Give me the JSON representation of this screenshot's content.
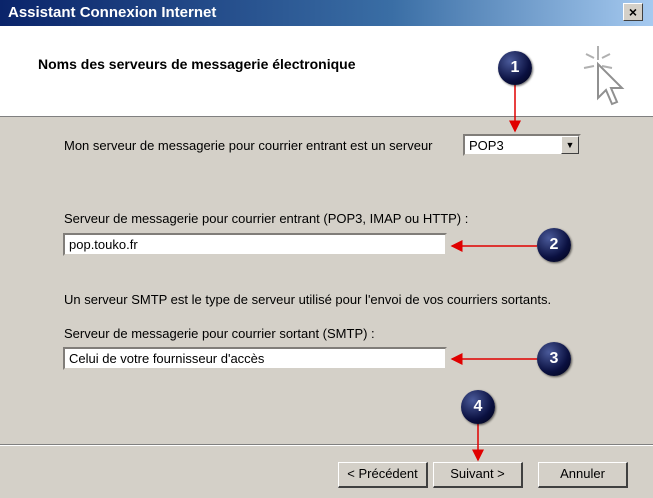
{
  "window": {
    "title": "Assistant Connexion Internet",
    "close_glyph": "×"
  },
  "header": {
    "title": "Noms des serveurs de messagerie électronique"
  },
  "form": {
    "incoming_type_label": "Mon serveur de messagerie pour courrier entrant est un serveur",
    "incoming_type_value": "POP3",
    "incoming_server_label": "Serveur de messagerie pour courrier entrant (POP3, IMAP ou HTTP) :",
    "incoming_server_value": "pop.touko.fr",
    "smtp_note": "Un serveur SMTP est le type de serveur utilisé pour l'envoi de vos courriers sortants.",
    "outgoing_server_label": "Serveur de messagerie pour courrier sortant (SMTP) :",
    "outgoing_server_value": "Celui de votre fournisseur d'accès"
  },
  "buttons": {
    "previous": "< Précédent",
    "next": "Suivant >",
    "cancel": "Annuler"
  },
  "annotations": {
    "badge1": "1",
    "badge2": "2",
    "badge3": "3",
    "badge4": "4",
    "badge_color": "#0a1040",
    "arrow_color": "#e00000"
  },
  "icons": {
    "header_icon": "wizard-cursor-sparkle-icon",
    "dropdown_icon": "chevron-down-icon"
  }
}
